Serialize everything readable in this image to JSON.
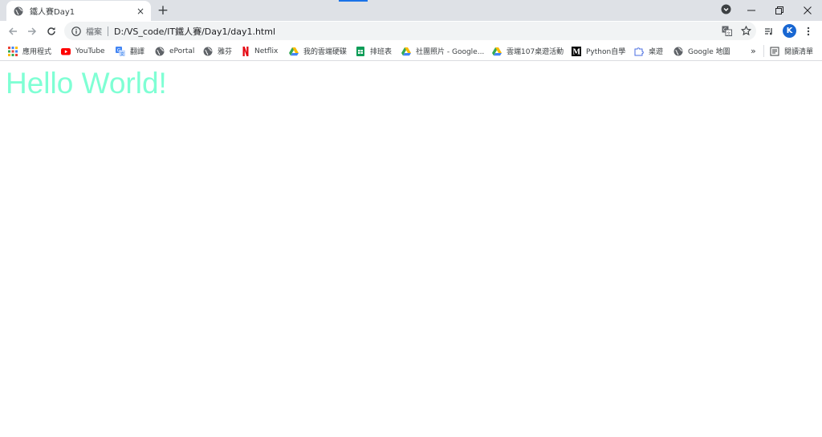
{
  "colors": {
    "heading": "#7fffd4",
    "tabstrip_bg": "#dee1e6",
    "omnibox_bg": "#f1f3f4",
    "avatar_bg": "#1967d2"
  },
  "tab": {
    "title": "鐵人賽Day1",
    "favicon": "globe-icon",
    "close": "×"
  },
  "new_tab_label": "+",
  "omnibox": {
    "scheme_label": "檔案",
    "url": "D:/VS_code/IT鐵人賽/Day1/day1.html"
  },
  "profile": {
    "initial": "K"
  },
  "bookmarks": [
    {
      "label": "應用程式",
      "icon": "apps-grid-icon"
    },
    {
      "label": "YouTube",
      "icon": "youtube-icon"
    },
    {
      "label": "翻譯",
      "icon": "translate-icon"
    },
    {
      "label": "ePortal",
      "icon": "globe-icon"
    },
    {
      "label": "雅芬",
      "icon": "globe-icon"
    },
    {
      "label": "Netflix",
      "icon": "netflix-icon"
    },
    {
      "label": "我的雲端硬碟",
      "icon": "google-drive-icon"
    },
    {
      "label": "排班表",
      "icon": "google-sheets-icon"
    },
    {
      "label": "社團照片 - Google...",
      "icon": "google-drive-icon"
    },
    {
      "label": "雲端107桌遊活動",
      "icon": "google-drive-icon"
    },
    {
      "label": "Python自學",
      "icon": "medium-icon"
    },
    {
      "label": "桌遊",
      "icon": "puzzle-icon"
    },
    {
      "label": "Google 地圖",
      "icon": "globe-icon"
    }
  ],
  "bookmarks_overflow": "»",
  "reading_list_label": "閱讀清單",
  "page": {
    "heading": "Hello World!"
  }
}
